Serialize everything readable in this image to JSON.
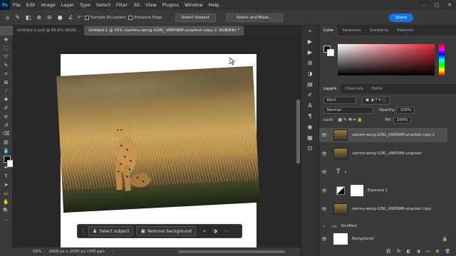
{
  "app": {
    "logo": "Ps"
  },
  "menu": [
    "File",
    "Edit",
    "Image",
    "Layer",
    "Type",
    "Select",
    "Filter",
    "3D",
    "View",
    "Plugins",
    "Window",
    "Help"
  ],
  "options": {
    "angle": "0°",
    "sample_all_layers": "Sample All Layers",
    "enhance_edge": "Enhance Edge",
    "select_subject": "Select Subject",
    "select_and_mask": "Select and Mask...",
    "share": "Share"
  },
  "tabs": [
    {
      "label": "Untitled-2.psd @ 66.6% (RGB/...",
      "active": false
    },
    {
      "label": "Untitled-1 @ 55% (sammy-wong-G3KL_kN80WM-unsplash copy 2, RGB/8#) *",
      "active": true
    }
  ],
  "context_bar": {
    "select_subject": "Select subject",
    "remove_background": "Remove background"
  },
  "status": {
    "zoom": "55%",
    "doc_size": "2000 px x 2000 px (300 ppi)"
  },
  "color_panel": {
    "tabs": [
      "Color",
      "Swatches",
      "Gradients",
      "Patterns"
    ],
    "hue": "#e32635"
  },
  "layers_panel": {
    "tabs": [
      "Layers",
      "Channels",
      "Paths"
    ],
    "filter_kind": "Kind",
    "blend_mode": "Normal",
    "opacity_label": "Opacity:",
    "opacity": "100%",
    "lock_label": "Lock:",
    "fill_label": "Fill:",
    "fill": "100%",
    "layers": [
      {
        "name": "sammy-wong-G3KL_kN80WM-unsplash copy 2",
        "selected": true
      },
      {
        "name": "sammy-wong-G3KL_kN80WM-unsplash",
        "selected": false
      },
      {
        "name": "",
        "type": "text"
      },
      {
        "name": "Exposure 1",
        "selected": false
      },
      {
        "name": "sammy-wong-G3KL_kN80WM-unsplash copy",
        "selected": false
      },
      {
        "name": "3d effect",
        "type": "group"
      },
      {
        "name": "Background",
        "type": "background"
      }
    ],
    "text_glyph": "T",
    "text_layer_glyph": "c",
    "fx_glyph": "fx"
  }
}
